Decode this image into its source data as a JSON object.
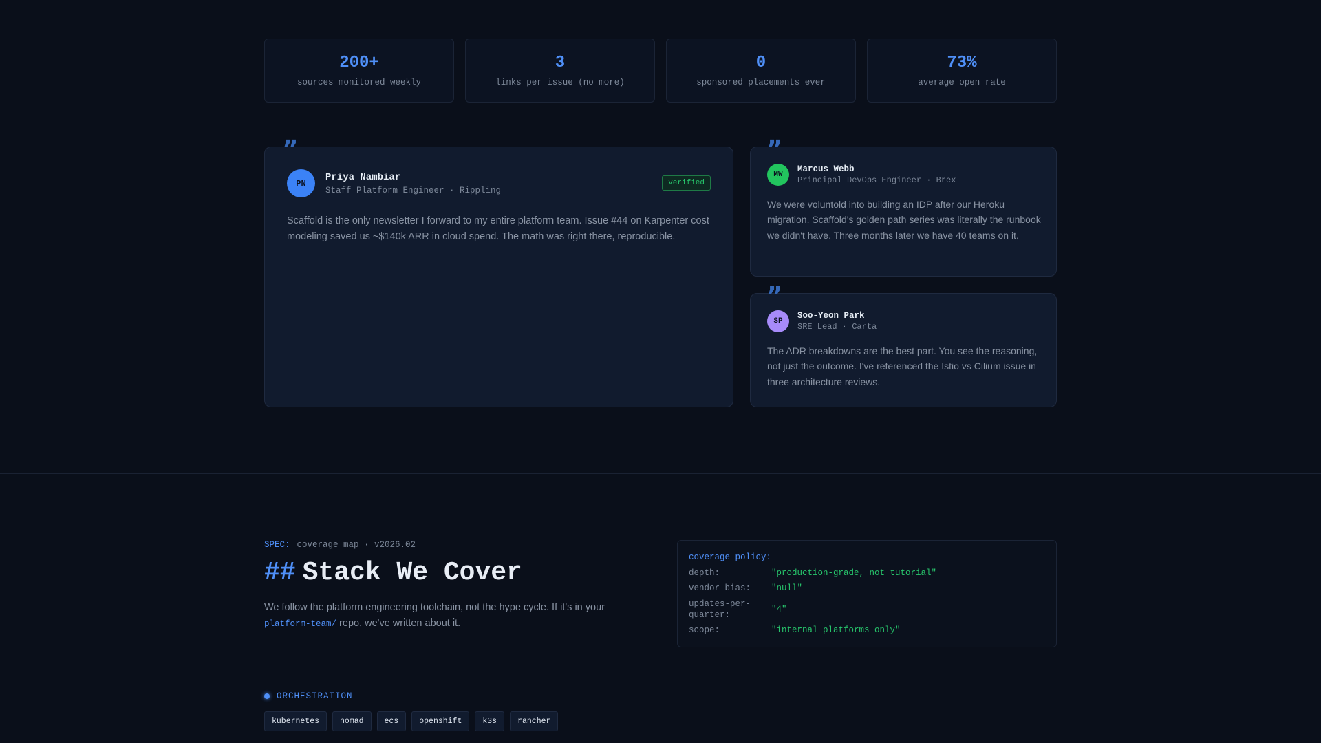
{
  "stats": [
    {
      "value": "200+",
      "label": "sources monitored weekly"
    },
    {
      "value": "3",
      "label": "links per issue (no more)"
    },
    {
      "value": "0",
      "label": "sponsored placements ever"
    },
    {
      "value": "73%",
      "label": "average open rate"
    }
  ],
  "testimonials": [
    {
      "quote_mark": "”",
      "initials": "PN",
      "name": "Priya Nambiar",
      "role": "Staff Platform Engineer · Rippling",
      "badge": "verified",
      "text": "Scaffold is the only newsletter I forward to my entire platform team. Issue #44 on Karpenter cost modeling saved us ~$140k ARR in cloud spend. The math was right there, reproducible.",
      "avatar_color": "#3b82f6"
    },
    {
      "quote_mark": "”",
      "initials": "MW",
      "name": "Marcus Webb",
      "role": "Principal DevOps Engineer · Brex",
      "text": "We were voluntold into building an IDP after our Heroku migration. Scaffold's golden path series was literally the runbook we didn't have. Three months later we have 40 teams on it.",
      "avatar_color": "#22c55e"
    },
    {
      "quote_mark": "”",
      "initials": "SP",
      "name": "Soo-Yeon Park",
      "role": "SRE Lead · Carta",
      "text": "The ADR breakdowns are the best part. You see the reasoning, not just the outcome. I've referenced the Istio vs Cilium issue in three architecture reviews.",
      "avatar_color": "#a78bfa"
    }
  ],
  "spec": {
    "key": "SPEC:",
    "value": "coverage map · v2026.02",
    "hash": "##",
    "title": "Stack We Cover",
    "lead_before": "We follow the platform engineering toolchain, not the hype cycle. If it's in your ",
    "lead_code": "platform-team/",
    "lead_after": " repo, we've written about it."
  },
  "policy": {
    "title": "coverage-policy:",
    "rows": [
      {
        "key": "depth:",
        "value": "\"production-grade, not tutorial\""
      },
      {
        "key": "vendor-bias:",
        "value": "\"null\""
      },
      {
        "key": "updates-per-quarter:",
        "value": "\"4\""
      },
      {
        "key": "scope:",
        "value": "\"internal platforms only\""
      }
    ]
  },
  "orchestration": {
    "title": "ORCHESTRATION",
    "tags": [
      "kubernetes",
      "nomad",
      "ecs",
      "openshift",
      "k3s",
      "rancher"
    ]
  },
  "colors": {
    "accent": "#4f8ff7",
    "green": "#27c46b",
    "background": "#0a0f1a"
  }
}
